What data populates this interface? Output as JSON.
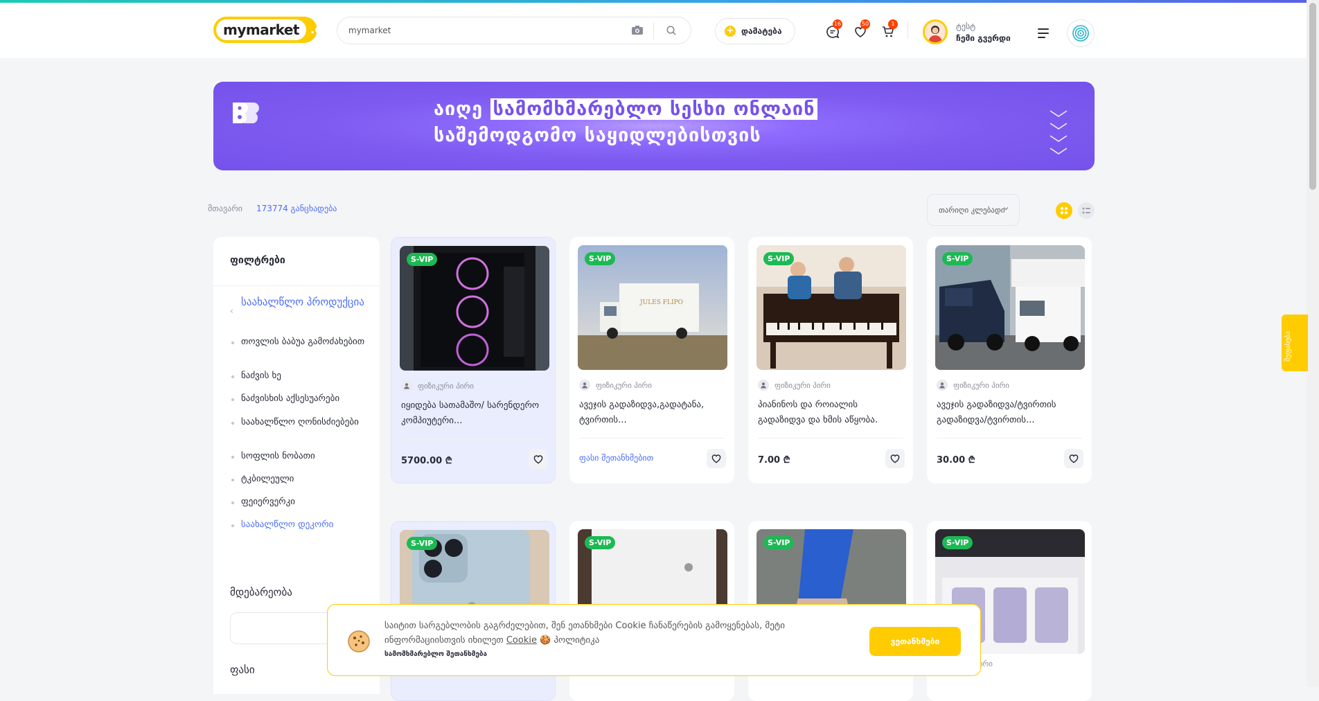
{
  "header": {
    "logo_main": "mymarket",
    "logo_suffix": ".ge",
    "search_value": "mymarket",
    "add_label": "დამატება",
    "messages_count": "16",
    "favorites_count": "50",
    "cart_count": "1",
    "user_name": "ტესტ",
    "user_page_label": "ჩემი გვერდი"
  },
  "banner": {
    "line1_plain": "აიღე",
    "line1_highlight": "სამომხმარებლო სესხი ონლაინ",
    "line2": "საშემოდგომო საყიდლებისთვის"
  },
  "breadcrumb": {
    "home": "მთავარი",
    "count": "173774 განცხადება"
  },
  "sort": {
    "selected": "თარიღი კლებადი"
  },
  "sidebar": {
    "filters_title": "ფილტრები",
    "main_category": "საახალწლო პროდუქცია",
    "subcategories": [
      "თოვლის ბაბუა გამოძახებით",
      "ნაძვის ხე",
      "ნაძვისხის აქსესუარები",
      "საახალწლო ღონისძიებები",
      "სოფლის ნობათი",
      "ტკბილეული",
      "ფეიერვერკი",
      "საახალწლო დეკორი"
    ],
    "location_title": "მდებარეობა",
    "price_title": "ფასი"
  },
  "cards": [
    {
      "badge": "S-VIP",
      "seller": "ფიზიკური პირი",
      "title": "იყიდება სათამაშო/ სარენდერო კომპიუტერი...",
      "price": "5700.00",
      "currency": "₾"
    },
    {
      "badge": "S-VIP",
      "seller": "ფიზიკური პირი",
      "title": "ავეჯის გადაზიდვა,გადატანა, ტვირთის...",
      "price": "ფასი შეთანხმებით",
      "currency": ""
    },
    {
      "badge": "S-VIP",
      "seller": "ფიზიკური პირი",
      "title": "პიანინოს და როიალის გადაზიდვა და ხმის აწყობა.",
      "price": "7.00",
      "currency": "₾"
    },
    {
      "badge": "S-VIP",
      "seller": "ფიზიკური პირი",
      "title": "ავეჯის გადაზიდვა/ტვირთის გადაზიდვა/ტვირთის...",
      "price": "30.00",
      "currency": "₾"
    }
  ],
  "row2": {
    "badge": "S-VIP",
    "seller_partial": "ფიზიკური პირი"
  },
  "cookie": {
    "text_before": "საიტით სარგებლობის გაგრძელებით, შენ ეთანხმები Cookie ჩანაწერების გამოყენებას, მეტი ინფორმაციისთვის იხილეთ",
    "link": "Cookie",
    "text_after": "პოლიტიკა",
    "bold": "სამომხმარებლო შეთანხმება",
    "accept_button": "ვეთანხმები"
  },
  "feedback": "შეფასება",
  "colors": {
    "accent_yellow": "#fecc00",
    "link_blue": "#4a6cfa",
    "svip_green": "#1db954",
    "banner_purple": "#7552ea",
    "badge_orange": "#fd4100"
  }
}
